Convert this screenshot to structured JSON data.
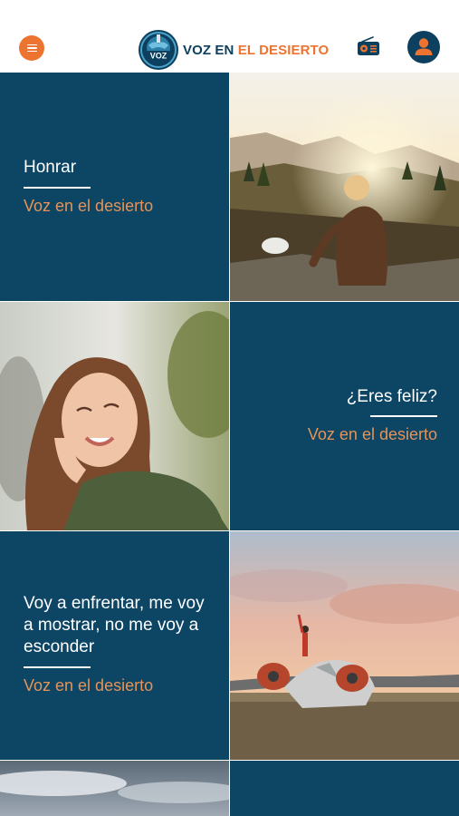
{
  "header": {
    "menu_icon": "hamburger-icon",
    "logo": {
      "badge_text": "VOZ",
      "word1": "VOZ EN",
      "word2": "EL DESIERTO"
    },
    "radio_icon": "radio-icon",
    "profile_icon": "user-icon"
  },
  "colors": {
    "brand_navy": "#0d4565",
    "accent_orange": "#ec7430",
    "subtitle_orange": "#e3945a"
  },
  "posts": [
    {
      "title": "Honrar",
      "subtitle": "Voz en el desierto",
      "image": "person-sitting-mountain-sunset"
    },
    {
      "title": "¿Eres feliz?",
      "subtitle": "Voz en el desierto",
      "image": "smiling-woman-green-shirt"
    },
    {
      "title": "Voy a enfrentar, me voy a mostrar, no me voy a esconder",
      "subtitle": "Voz en el desierto",
      "image": "person-standing-on-old-airplane"
    },
    {
      "title": "",
      "subtitle": "",
      "image": "cloudy-sky"
    }
  ]
}
